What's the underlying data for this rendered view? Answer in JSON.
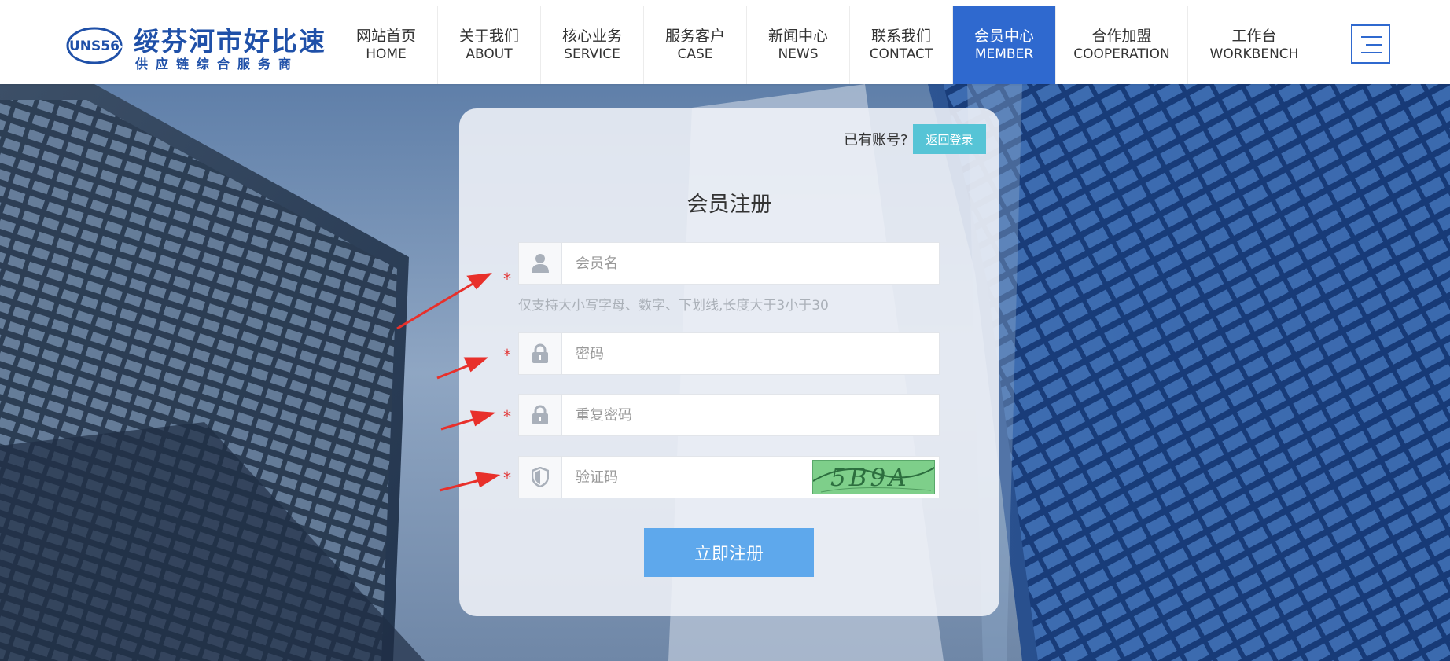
{
  "brand": {
    "mark": "UNS56",
    "name": "绥芬河市好比速",
    "tagline": "供应链综合服务商",
    "color": "#1f50a8"
  },
  "nav": [
    {
      "cn": "网站首页",
      "en": "HOME"
    },
    {
      "cn": "关于我们",
      "en": "ABOUT"
    },
    {
      "cn": "核心业务",
      "en": "SERVICE"
    },
    {
      "cn": "服务客户",
      "en": "CASE"
    },
    {
      "cn": "新闻中心",
      "en": "NEWS"
    },
    {
      "cn": "联系我们",
      "en": "CONTACT"
    },
    {
      "cn": "会员中心",
      "en": "MEMBER",
      "active": true
    },
    {
      "cn": "合作加盟",
      "en": "COOPERATION"
    },
    {
      "cn": "工作台",
      "en": "WORKBENCH"
    }
  ],
  "menu_icon": "hamburger-icon",
  "register": {
    "has_account": "已有账号?",
    "back_login": "返回登录",
    "title": "会员注册",
    "required_mark": "*",
    "fields": {
      "username": {
        "placeholder": "会员名",
        "value": "",
        "icon": "user-icon"
      },
      "password": {
        "placeholder": "密码",
        "value": "",
        "icon": "lock-icon"
      },
      "password_repeat": {
        "placeholder": "重复密码",
        "value": "",
        "icon": "lock-icon"
      },
      "captcha": {
        "placeholder": "验证码",
        "value": "",
        "icon": "shield-icon",
        "image_text": "5B9A"
      }
    },
    "username_hint": "仅支持大小写字母、数字、下划线,长度大于3小于30",
    "submit": "立即注册"
  },
  "colors": {
    "nav_active": "#2f69cf",
    "back_login_button": "#56c4d6",
    "submit_button": "#5ea8ec",
    "required": "#e23b3b",
    "annotation_arrow": "#e8302b"
  }
}
